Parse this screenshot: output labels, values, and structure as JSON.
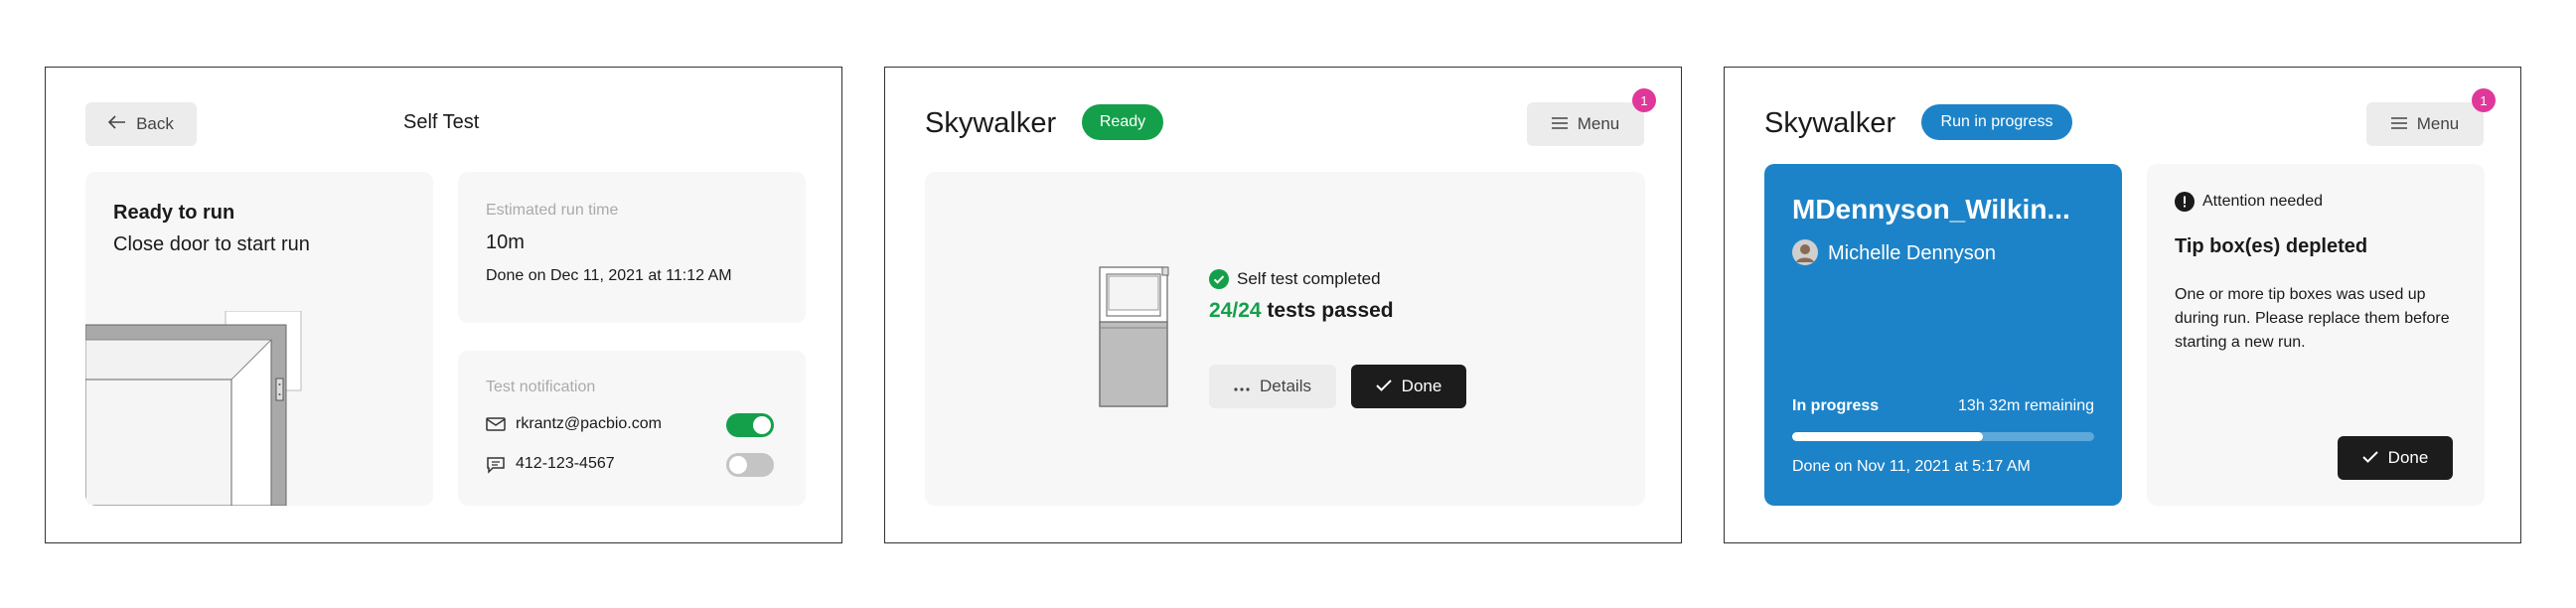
{
  "screen1": {
    "back_label": "Back",
    "title": "Self Test",
    "status_heading": "Ready to run",
    "status_text": "Close door to start run",
    "estimate": {
      "label": "Estimated run time",
      "value": "10m",
      "done_text": "Done on Dec 11, 2021 at 11:12 AM"
    },
    "notification": {
      "label": "Test notification",
      "email": "rkrantz@pacbio.com",
      "email_on": true,
      "phone": "412-123-4567",
      "phone_on": false
    }
  },
  "screen2": {
    "instrument": "Skywalker",
    "status": "Ready",
    "menu_label": "Menu",
    "menu_badge": "1",
    "result_label": "Self test completed",
    "score": "24/24",
    "score_suffix": "tests passed",
    "details_label": "Details",
    "done_label": "Done"
  },
  "screen3": {
    "instrument": "Skywalker",
    "status": "Run in progress",
    "menu_label": "Menu",
    "menu_badge": "1",
    "run": {
      "name": "MDennyson_Wilkin...",
      "user": "Michelle Dennyson",
      "state_label": "In progress",
      "remaining": "13h 32m remaining",
      "progress": 0.63,
      "done_text": "Done on Nov 11, 2021 at 5:17 AM"
    },
    "alert": {
      "label": "Attention needed",
      "title": "Tip box(es) depleted",
      "body": "One or more tip boxes was used up during run. Please replace them before starting a new run.",
      "done_label": "Done"
    }
  },
  "colors": {
    "green": "#14a04a",
    "blue": "#1d83c8",
    "magenta": "#e0389a",
    "dark": "#1c1c1c"
  }
}
